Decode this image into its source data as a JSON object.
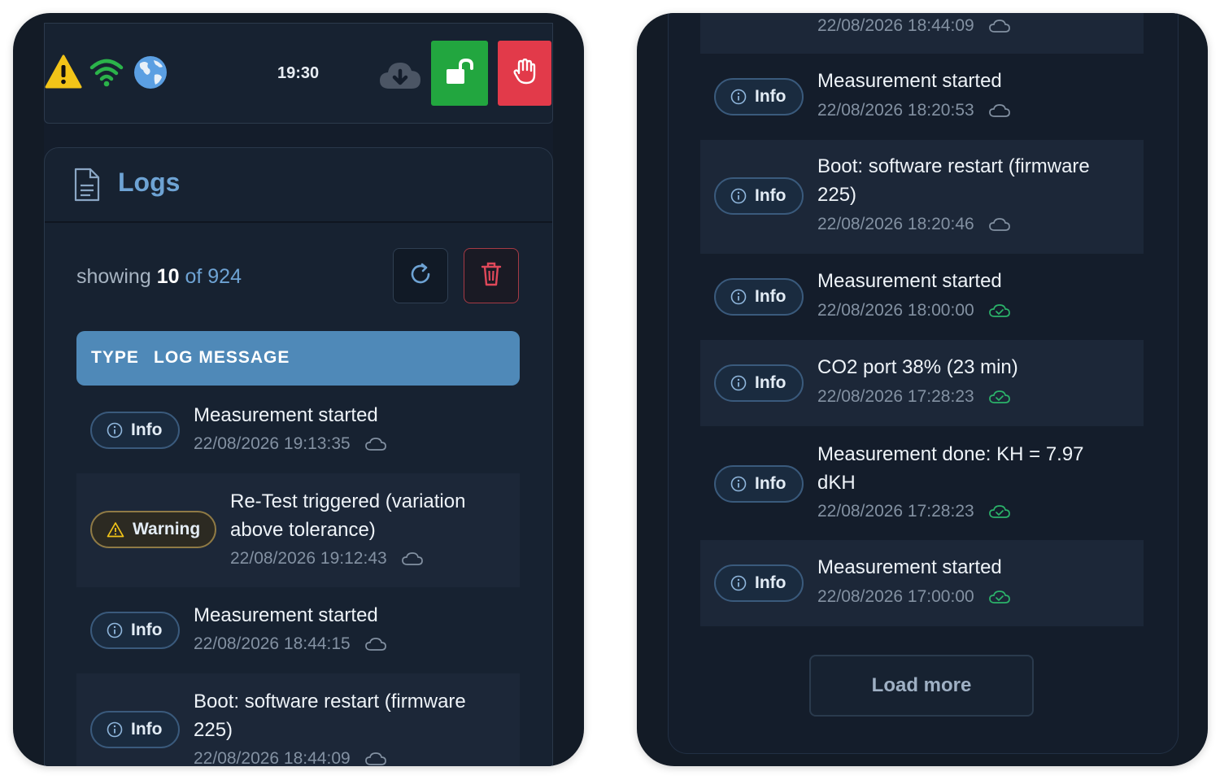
{
  "status_bar": {
    "time": "19:30",
    "icons": [
      "warning-icon",
      "wifi-icon",
      "globe-icon",
      "cloud-download-icon",
      "unlock-icon",
      "hand-stop-icon"
    ]
  },
  "logs": {
    "title": "Logs",
    "showing_prefix": "showing",
    "showing_count": "10",
    "showing_of": "of",
    "showing_total": "924",
    "columns": {
      "type": "TYPE",
      "message": "LOG MESSAGE"
    },
    "load_more": "Load more",
    "partial_top_timestamp": "22/08/2026 18:44:09",
    "left_entries": [
      {
        "type": "Info",
        "message": "Measurement started",
        "timestamp": "22/08/2026 19:13:35",
        "synced": false
      },
      {
        "type": "Warning",
        "message": "Re-Test triggered (variation above tolerance)",
        "timestamp": "22/08/2026 19:12:43",
        "synced": false
      },
      {
        "type": "Info",
        "message": "Measurement started",
        "timestamp": "22/08/2026 18:44:15",
        "synced": false
      },
      {
        "type": "Info",
        "message": "Boot: software restart (firmware 225)",
        "timestamp": "22/08/2026 18:44:09",
        "synced": false
      }
    ],
    "right_entries": [
      {
        "type": "Info",
        "message": "Measurement started",
        "timestamp": "22/08/2026 18:20:53",
        "synced": false
      },
      {
        "type": "Info",
        "message": "Boot: software restart (firmware 225)",
        "timestamp": "22/08/2026 18:20:46",
        "synced": false
      },
      {
        "type": "Info",
        "message": "Measurement started",
        "timestamp": "22/08/2026 18:00:00",
        "synced": true
      },
      {
        "type": "Info",
        "message": "CO2 port 38% (23 min)",
        "timestamp": "22/08/2026 17:28:23",
        "synced": true
      },
      {
        "type": "Info",
        "message": "Measurement done: KH = 7.97 dKH",
        "timestamp": "22/08/2026 17:28:23",
        "synced": true
      },
      {
        "type": "Info",
        "message": "Measurement started",
        "timestamp": "22/08/2026 17:00:00",
        "synced": true
      }
    ]
  },
  "colors": {
    "accent": "#4f89b8",
    "unlock": "#22a63f",
    "stop": "#e23a4a",
    "warning": "#f2c418",
    "wifi": "#2bb34a",
    "synced": "#2bb36a"
  }
}
